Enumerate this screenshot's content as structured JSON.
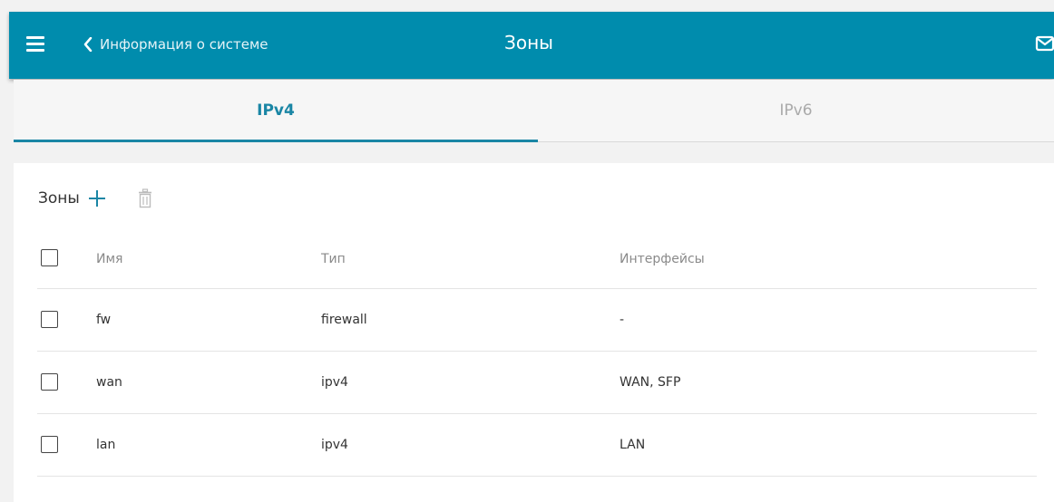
{
  "header": {
    "back_label": "Информация о системе",
    "title": "Зоны"
  },
  "tabs": [
    {
      "label": "IPv4",
      "active": true
    },
    {
      "label": "IPv6",
      "active": false
    }
  ],
  "section": {
    "title": "Зоны"
  },
  "table": {
    "columns": [
      "Имя",
      "Тип",
      "Интерфейсы"
    ],
    "rows": [
      {
        "name": "fw",
        "type": "firewall",
        "interfaces": "-"
      },
      {
        "name": "wan",
        "type": "ipv4",
        "interfaces": "WAN, SFP"
      },
      {
        "name": "lan",
        "type": "ipv4",
        "interfaces": "LAN"
      }
    ]
  },
  "icons": [
    "menu-icon",
    "chevron-left-icon",
    "mail-icon",
    "plus-icon",
    "trash-icon"
  ],
  "colors": {
    "header_bg": "#008cad",
    "accent": "#1a86a5",
    "inactive_tab": "#aaaaaa"
  }
}
